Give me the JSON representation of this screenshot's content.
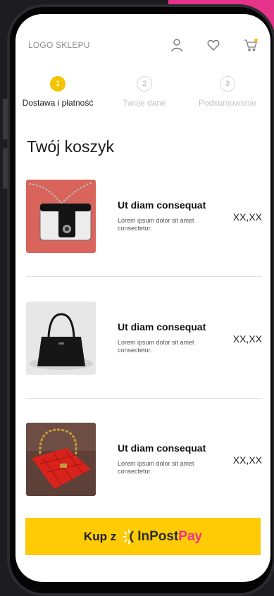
{
  "header": {
    "logo": "LOGO SKLEPU",
    "icons": [
      "user-icon",
      "heart-icon",
      "cart-icon"
    ]
  },
  "steps": [
    {
      "number": "1",
      "label": "Dostawa i płatność",
      "active": true
    },
    {
      "number": "2",
      "label": "Twoje dane",
      "active": false
    },
    {
      "number": "3",
      "label": "Podsumowanie",
      "active": false
    }
  ],
  "cart": {
    "title": "Twój koszyk",
    "items": [
      {
        "name": "Ut diam consequat",
        "description": "Lorem ipsum dolor sit amet consectetur.",
        "price": "XX,XX"
      },
      {
        "name": "Ut diam consequat",
        "description": "Lorem ipsum dolor sit amet consectetur.",
        "price": "XX,XX"
      },
      {
        "name": "Ut diam consequat",
        "description": "Lorem ipsum dolor sit amet consectetur.",
        "price": "XX,XX"
      }
    ]
  },
  "buy": {
    "prefix": "Kup z",
    "brand_first": "InPost",
    "brand_second": "Pay"
  },
  "colors": {
    "accent": "#ffcb05",
    "step_active": "#f5c400",
    "brand_pink": "#f0318f",
    "background_pink": "#e6338a"
  }
}
